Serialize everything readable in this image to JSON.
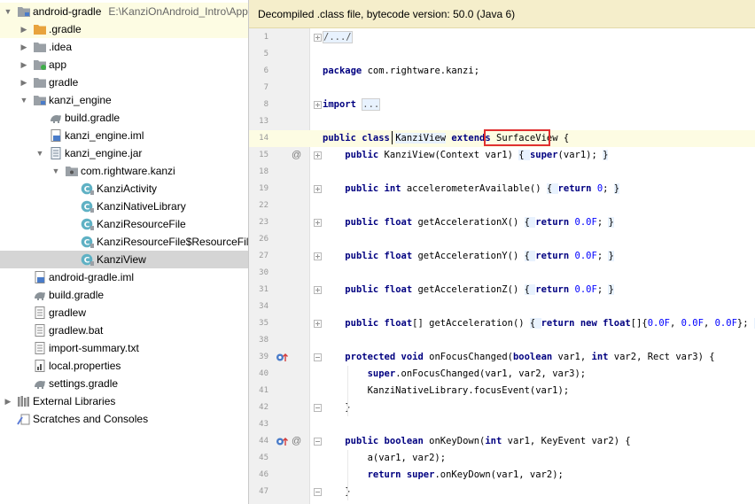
{
  "tree": [
    {
      "level": 0,
      "label": "android-gradle",
      "path": "E:\\KanziOnAndroid_Intro\\App",
      "arrow": "down",
      "icon": "module-folder-icon",
      "state": "hl"
    },
    {
      "level": 1,
      "label": ".gradle",
      "arrow": "right",
      "icon": "orange-folder-icon",
      "state": "hl"
    },
    {
      "level": 1,
      "label": ".idea",
      "arrow": "right",
      "icon": "folder-icon",
      "state": ""
    },
    {
      "level": 1,
      "label": "app",
      "arrow": "right",
      "icon": "app-module-folder-icon",
      "state": ""
    },
    {
      "level": 1,
      "label": "gradle",
      "arrow": "right",
      "icon": "folder-icon",
      "state": ""
    },
    {
      "level": 1,
      "label": "kanzi_engine",
      "arrow": "down",
      "icon": "module-folder-icon",
      "state": ""
    },
    {
      "level": 2,
      "label": "build.gradle",
      "arrow": "",
      "icon": "gradle-icon",
      "state": ""
    },
    {
      "level": 2,
      "label": "kanzi_engine.iml",
      "arrow": "",
      "icon": "iml-file-icon",
      "state": ""
    },
    {
      "level": 2,
      "label": "kanzi_engine.jar",
      "arrow": "down",
      "icon": "jar-icon",
      "state": ""
    },
    {
      "level": 3,
      "label": "com.rightware.kanzi",
      "arrow": "down",
      "icon": "package-icon",
      "state": ""
    },
    {
      "level": 4,
      "label": "KanziActivity",
      "arrow": "",
      "icon": "class-icon",
      "state": ""
    },
    {
      "level": 4,
      "label": "KanziNativeLibrary",
      "arrow": "",
      "icon": "class-icon",
      "state": ""
    },
    {
      "level": 4,
      "label": "KanziResourceFile",
      "arrow": "",
      "icon": "class-icon",
      "state": ""
    },
    {
      "level": 4,
      "label": "KanziResourceFile$ResourceFile",
      "arrow": "",
      "icon": "class-icon",
      "state": ""
    },
    {
      "level": 4,
      "label": "KanziView",
      "arrow": "",
      "icon": "class-icon",
      "state": "sel"
    },
    {
      "level": 1,
      "label": "android-gradle.iml",
      "arrow": "",
      "icon": "iml-file-icon",
      "state": ""
    },
    {
      "level": 1,
      "label": "build.gradle",
      "arrow": "",
      "icon": "gradle-icon",
      "state": ""
    },
    {
      "level": 1,
      "label": "gradlew",
      "arrow": "",
      "icon": "text-file-icon",
      "state": ""
    },
    {
      "level": 1,
      "label": "gradlew.bat",
      "arrow": "",
      "icon": "text-file-icon",
      "state": ""
    },
    {
      "level": 1,
      "label": "import-summary.txt",
      "arrow": "",
      "icon": "text-file-icon",
      "state": ""
    },
    {
      "level": 1,
      "label": "local.properties",
      "arrow": "",
      "icon": "properties-icon",
      "state": ""
    },
    {
      "level": 1,
      "label": "settings.gradle",
      "arrow": "",
      "icon": "gradle-icon",
      "state": ""
    },
    {
      "level": 0,
      "label": "External Libraries",
      "arrow": "right",
      "icon": "libraries-icon",
      "state": ""
    },
    {
      "level": 0,
      "label": "Scratches and Consoles",
      "arrow": "",
      "icon": "scratches-icon",
      "state": ""
    }
  ],
  "editor": {
    "banner": "Decompiled .class file, bytecode version: 50.0 (Java 6)",
    "highlighted_word": "SurfaceView",
    "lines": [
      {
        "n": "1",
        "fold": "plus",
        "gutter": "",
        "segs": [
          {
            "t": "/.../",
            "c": "coll"
          }
        ]
      },
      {
        "n": "5",
        "fold": "",
        "gutter": "",
        "segs": []
      },
      {
        "n": "6",
        "fold": "",
        "gutter": "",
        "segs": [
          {
            "t": "package",
            "c": "kw"
          },
          {
            "t": " com.rightware.kanzi;",
            "c": ""
          }
        ]
      },
      {
        "n": "7",
        "fold": "",
        "gutter": "",
        "segs": []
      },
      {
        "n": "8",
        "fold": "plus",
        "gutter": "",
        "segs": [
          {
            "t": "import",
            "c": "kw"
          },
          {
            "t": " ",
            "c": ""
          },
          {
            "t": "...",
            "c": "coll"
          }
        ]
      },
      {
        "n": "13",
        "fold": "",
        "gutter": "",
        "segs": []
      },
      {
        "n": "14",
        "fold": "",
        "gutter": "",
        "cur": true,
        "segs": [
          {
            "t": "public class ",
            "c": "kw"
          },
          {
            "t": "KanziView",
            "c": "brace"
          },
          {
            "t": " ",
            "c": ""
          },
          {
            "t": "extends ",
            "c": "kw"
          },
          {
            "t": "SurfaceView",
            "c": ""
          },
          {
            "t": " {",
            "c": ""
          }
        ]
      },
      {
        "n": "15",
        "fold": "plus",
        "gutter": "@",
        "segs": [
          {
            "t": "    ",
            "c": ""
          },
          {
            "t": "public",
            "c": "kw"
          },
          {
            "t": " KanziView(Context var1) ",
            "c": ""
          },
          {
            "t": "{ ",
            "c": "brace"
          },
          {
            "t": "super",
            "c": "kw"
          },
          {
            "t": "(var1); ",
            "c": ""
          },
          {
            "t": "}",
            "c": "brace"
          }
        ]
      },
      {
        "n": "18",
        "fold": "",
        "gutter": "",
        "segs": []
      },
      {
        "n": "19",
        "fold": "plus",
        "gutter": "",
        "segs": [
          {
            "t": "    ",
            "c": ""
          },
          {
            "t": "public int",
            "c": "kw"
          },
          {
            "t": " accelerometerAvailable() ",
            "c": ""
          },
          {
            "t": "{ ",
            "c": "brace"
          },
          {
            "t": "return ",
            "c": "kw"
          },
          {
            "t": "0",
            "c": "num"
          },
          {
            "t": "; ",
            "c": ""
          },
          {
            "t": "}",
            "c": "brace"
          }
        ]
      },
      {
        "n": "22",
        "fold": "",
        "gutter": "",
        "segs": []
      },
      {
        "n": "23",
        "fold": "plus",
        "gutter": "",
        "segs": [
          {
            "t": "    ",
            "c": ""
          },
          {
            "t": "public float",
            "c": "kw"
          },
          {
            "t": " getAccelerationX() ",
            "c": ""
          },
          {
            "t": "{ ",
            "c": "brace"
          },
          {
            "t": "return ",
            "c": "kw"
          },
          {
            "t": "0.0F",
            "c": "num"
          },
          {
            "t": "; ",
            "c": ""
          },
          {
            "t": "}",
            "c": "brace"
          }
        ]
      },
      {
        "n": "26",
        "fold": "",
        "gutter": "",
        "segs": []
      },
      {
        "n": "27",
        "fold": "plus",
        "gutter": "",
        "segs": [
          {
            "t": "    ",
            "c": ""
          },
          {
            "t": "public float",
            "c": "kw"
          },
          {
            "t": " getAccelerationY() ",
            "c": ""
          },
          {
            "t": "{ ",
            "c": "brace"
          },
          {
            "t": "return ",
            "c": "kw"
          },
          {
            "t": "0.0F",
            "c": "num"
          },
          {
            "t": "; ",
            "c": ""
          },
          {
            "t": "}",
            "c": "brace"
          }
        ]
      },
      {
        "n": "30",
        "fold": "",
        "gutter": "",
        "segs": []
      },
      {
        "n": "31",
        "fold": "plus",
        "gutter": "",
        "segs": [
          {
            "t": "    ",
            "c": ""
          },
          {
            "t": "public float",
            "c": "kw"
          },
          {
            "t": " getAccelerationZ() ",
            "c": ""
          },
          {
            "t": "{ ",
            "c": "brace"
          },
          {
            "t": "return ",
            "c": "kw"
          },
          {
            "t": "0.0F",
            "c": "num"
          },
          {
            "t": "; ",
            "c": ""
          },
          {
            "t": "}",
            "c": "brace"
          }
        ]
      },
      {
        "n": "34",
        "fold": "",
        "gutter": "",
        "segs": []
      },
      {
        "n": "35",
        "fold": "plus",
        "gutter": "",
        "segs": [
          {
            "t": "    ",
            "c": ""
          },
          {
            "t": "public float",
            "c": "kw"
          },
          {
            "t": "[] getAcceleration() ",
            "c": ""
          },
          {
            "t": "{ ",
            "c": "brace"
          },
          {
            "t": "return new float",
            "c": "kw"
          },
          {
            "t": "[]{",
            "c": ""
          },
          {
            "t": "0.0F",
            "c": "num"
          },
          {
            "t": ", ",
            "c": ""
          },
          {
            "t": "0.0F",
            "c": "num"
          },
          {
            "t": ", ",
            "c": ""
          },
          {
            "t": "0.0F",
            "c": "num"
          },
          {
            "t": "}; ",
            "c": ""
          },
          {
            "t": "}",
            "c": "brace"
          }
        ]
      },
      {
        "n": "38",
        "fold": "",
        "gutter": "",
        "segs": []
      },
      {
        "n": "39",
        "fold": "minus",
        "gutter": "o↑",
        "segs": [
          {
            "t": "    ",
            "c": ""
          },
          {
            "t": "protected void",
            "c": "kw"
          },
          {
            "t": " onFocusChanged(",
            "c": ""
          },
          {
            "t": "boolean",
            "c": "kw"
          },
          {
            "t": " var1, ",
            "c": ""
          },
          {
            "t": "int",
            "c": "kw"
          },
          {
            "t": " var2, Rect var3) {",
            "c": ""
          }
        ]
      },
      {
        "n": "40",
        "fold": "",
        "gutter": "",
        "segs": [
          {
            "t": "        ",
            "c": ""
          },
          {
            "t": "super",
            "c": "kw"
          },
          {
            "t": ".onFocusChanged(var1, var2, var3);",
            "c": ""
          }
        ]
      },
      {
        "n": "41",
        "fold": "",
        "gutter": "",
        "segs": [
          {
            "t": "        KanziNativeLibrary.focusEvent(var1);",
            "c": ""
          }
        ]
      },
      {
        "n": "42",
        "fold": "minus",
        "gutter": "",
        "segs": [
          {
            "t": "    }",
            "c": ""
          }
        ]
      },
      {
        "n": "43",
        "fold": "",
        "gutter": "",
        "segs": []
      },
      {
        "n": "44",
        "fold": "minus",
        "gutter": "o↑@",
        "segs": [
          {
            "t": "    ",
            "c": ""
          },
          {
            "t": "public boolean",
            "c": "kw"
          },
          {
            "t": " onKeyDown(",
            "c": ""
          },
          {
            "t": "int",
            "c": "kw"
          },
          {
            "t": " var1, KeyEvent var2) {",
            "c": ""
          }
        ]
      },
      {
        "n": "45",
        "fold": "",
        "gutter": "",
        "segs": [
          {
            "t": "        a(var1, var2);",
            "c": ""
          }
        ]
      },
      {
        "n": "46",
        "fold": "",
        "gutter": "",
        "segs": [
          {
            "t": "        ",
            "c": ""
          },
          {
            "t": "return super",
            "c": "kw"
          },
          {
            "t": ".onKeyDown(var1, var2);",
            "c": ""
          }
        ]
      },
      {
        "n": "47",
        "fold": "minus",
        "gutter": "",
        "segs": [
          {
            "t": "    }",
            "c": ""
          }
        ]
      }
    ]
  }
}
